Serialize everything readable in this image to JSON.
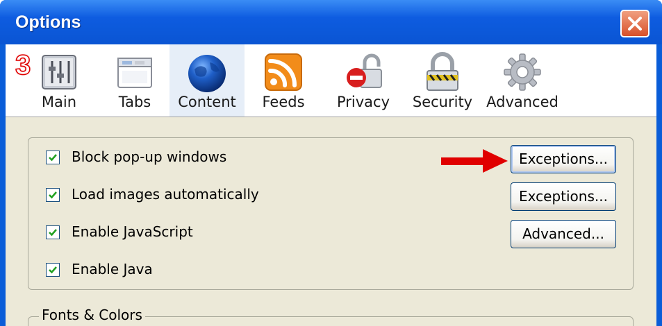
{
  "window": {
    "title": "Options"
  },
  "step_number": "3",
  "tabs": [
    {
      "label": "Main",
      "icon": "slider-panel-icon"
    },
    {
      "label": "Tabs",
      "icon": "browser-tabs-icon"
    },
    {
      "label": "Content",
      "icon": "globe-icon",
      "selected": true
    },
    {
      "label": "Feeds",
      "icon": "rss-feed-icon"
    },
    {
      "label": "Privacy",
      "icon": "privacy-lock-icon"
    },
    {
      "label": "Security",
      "icon": "security-padlock-icon"
    },
    {
      "label": "Advanced",
      "icon": "gear-icon"
    }
  ],
  "content": {
    "options": [
      {
        "label": "Block pop-up windows",
        "checked": true
      },
      {
        "label": "Load images automatically",
        "checked": true
      },
      {
        "label": "Enable JavaScript",
        "checked": true
      },
      {
        "label": "Enable Java",
        "checked": true
      }
    ],
    "buttons": {
      "popup_exceptions": "Exceptions...",
      "images_exceptions": "Exceptions...",
      "javascript_advanced": "Advanced..."
    },
    "fonts_group_label": "Fonts & Colors"
  },
  "colors": {
    "titlebar": "#0a55d3",
    "close_button": "#d8502a",
    "annotation_red": "#e00000",
    "dialog_background": "#ece9d8",
    "checkmark": "#21a121"
  }
}
